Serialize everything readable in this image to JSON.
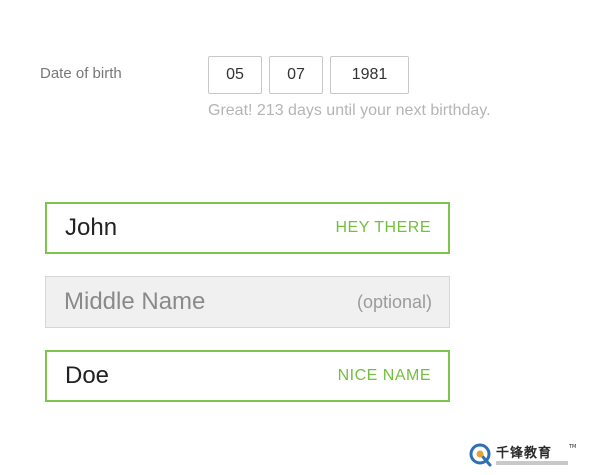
{
  "dob": {
    "label": "Date of birth",
    "day": "05",
    "month": "07",
    "year": "1981",
    "hint": "Great! 213 days until your next birthday."
  },
  "name": {
    "first": {
      "value": "John",
      "tag": "HEY THERE"
    },
    "middle": {
      "placeholder": "Middle Name",
      "tag": "(optional)"
    },
    "last": {
      "value": "Doe",
      "tag": "NICE NAME"
    }
  },
  "colors": {
    "valid_border": "#7cc44a",
    "valid_tag": "#74bf3f",
    "hint": "#b5b5b5",
    "empty_background": "#f0f0f0"
  },
  "watermark": {
    "text": "千锋教育",
    "trademark": "TM",
    "icon": "logo-q-icon"
  }
}
